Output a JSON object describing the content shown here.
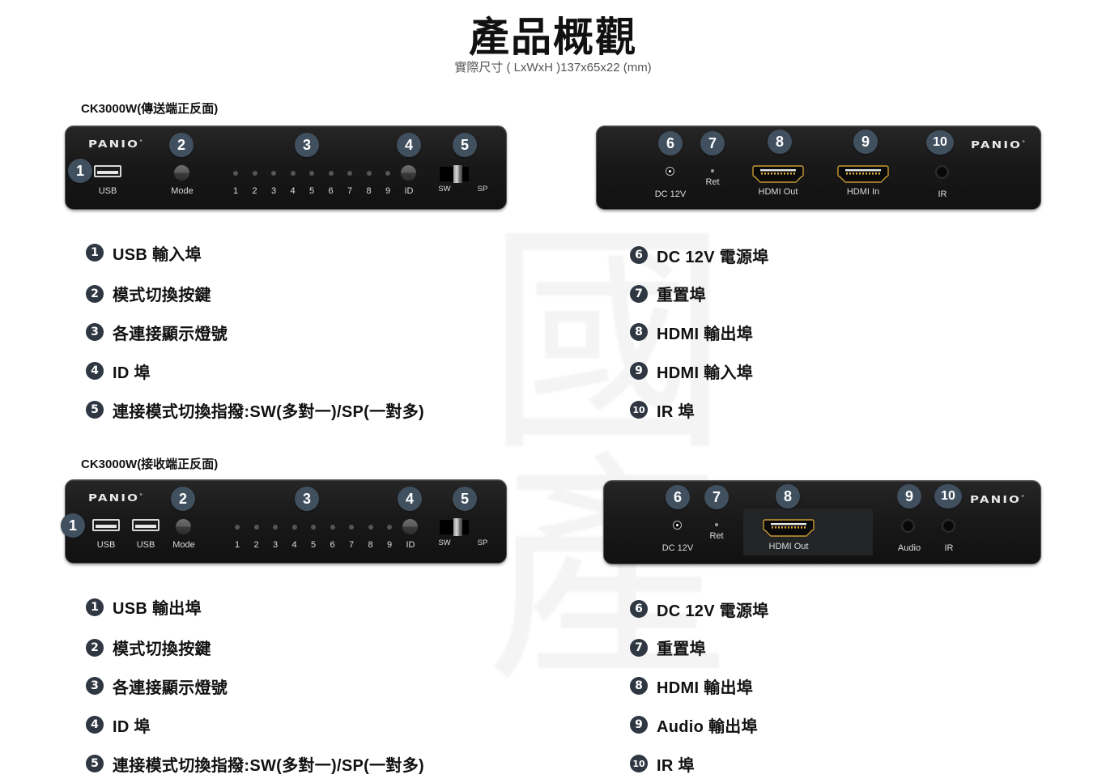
{
  "header": {
    "title": "產品概觀",
    "subtitle": "實際尺寸 ( LxWxH )137x65x22 (mm)"
  },
  "colors": {
    "badge_device": "#41505f",
    "badge_legend": "#2e3742",
    "chassis": "#1a1a1a",
    "hdmi_gold": "#c99a33",
    "text": "#111111"
  },
  "sections": [
    {
      "label": "CK3000W(傳送端正反面)",
      "front_panel": {
        "brand": "PANIO",
        "badges": [
          "1",
          "2",
          "3",
          "4",
          "5"
        ],
        "ports": [
          {
            "name": "usb-port",
            "label": "USB"
          },
          {
            "name": "mode-button",
            "label": "Mode"
          },
          {
            "name": "id-button",
            "label": "ID"
          }
        ],
        "led_labels": [
          "1",
          "2",
          "3",
          "4",
          "5",
          "6",
          "7",
          "8",
          "9"
        ],
        "switch": {
          "left_label": "SW",
          "right_label": "SP"
        }
      },
      "rear_panel": {
        "brand": "PANIO",
        "badges": [
          "6",
          "7",
          "8",
          "9",
          "10"
        ],
        "ports": [
          {
            "name": "dc-power-jack",
            "label": "DC 12V"
          },
          {
            "name": "reset-pinhole",
            "label": "Ret"
          },
          {
            "name": "hdmi-out-port",
            "label": "HDMI Out"
          },
          {
            "name": "hdmi-in-port",
            "label": "HDMI In"
          },
          {
            "name": "ir-jack",
            "label": "IR"
          }
        ]
      },
      "legend_left": [
        {
          "num": "1",
          "text": "USB 輸入埠"
        },
        {
          "num": "2",
          "text": "模式切換按鍵"
        },
        {
          "num": "3",
          "text": "各連接顯示燈號"
        },
        {
          "num": "4",
          "text": "ID 埠"
        },
        {
          "num": "5",
          "text": "連接模式切換指撥:SW(多對一)/SP(一對多)"
        }
      ],
      "legend_right": [
        {
          "num": "6",
          "text": "DC 12V 電源埠"
        },
        {
          "num": "7",
          "text": "重置埠"
        },
        {
          "num": "8",
          "text": "HDMI 輸出埠"
        },
        {
          "num": "9",
          "text": "HDMI 輸入埠"
        },
        {
          "num": "10",
          "text": "IR 埠"
        }
      ]
    },
    {
      "label": "CK3000W(接收端正反面)",
      "front_panel": {
        "brand": "PANIO",
        "badges": [
          "1",
          "2",
          "3",
          "4",
          "5"
        ],
        "ports": [
          {
            "name": "usb-port-1",
            "label": "USB"
          },
          {
            "name": "usb-port-2",
            "label": "USB"
          },
          {
            "name": "mode-button",
            "label": "Mode"
          },
          {
            "name": "id-button",
            "label": "ID"
          }
        ],
        "led_labels": [
          "1",
          "2",
          "3",
          "4",
          "5",
          "6",
          "7",
          "8",
          "9"
        ],
        "switch": {
          "left_label": "SW",
          "right_label": "SP"
        }
      },
      "rear_panel": {
        "brand": "PANIO",
        "badges": [
          "6",
          "7",
          "8",
          "9",
          "10"
        ],
        "ports": [
          {
            "name": "dc-power-jack",
            "label": "DC 12V"
          },
          {
            "name": "reset-pinhole",
            "label": "Ret"
          },
          {
            "name": "hdmi-out-port",
            "label": "HDMI Out"
          },
          {
            "name": "audio-jack",
            "label": "Audio"
          },
          {
            "name": "ir-jack",
            "label": "IR"
          }
        ]
      },
      "legend_left": [
        {
          "num": "1",
          "text": "USB 輸出埠"
        },
        {
          "num": "2",
          "text": "模式切換按鍵"
        },
        {
          "num": "3",
          "text": "各連接顯示燈號"
        },
        {
          "num": "4",
          "text": "ID 埠"
        },
        {
          "num": "5",
          "text": "連接模式切換指撥:SW(多對一)/SP(一對多)"
        }
      ],
      "legend_right": [
        {
          "num": "6",
          "text": "DC 12V 電源埠"
        },
        {
          "num": "7",
          "text": "重置埠"
        },
        {
          "num": "8",
          "text": "HDMI 輸出埠"
        },
        {
          "num": "9",
          "text": "Audio 輸出埠"
        },
        {
          "num": "10",
          "text": "IR 埠"
        }
      ]
    }
  ]
}
